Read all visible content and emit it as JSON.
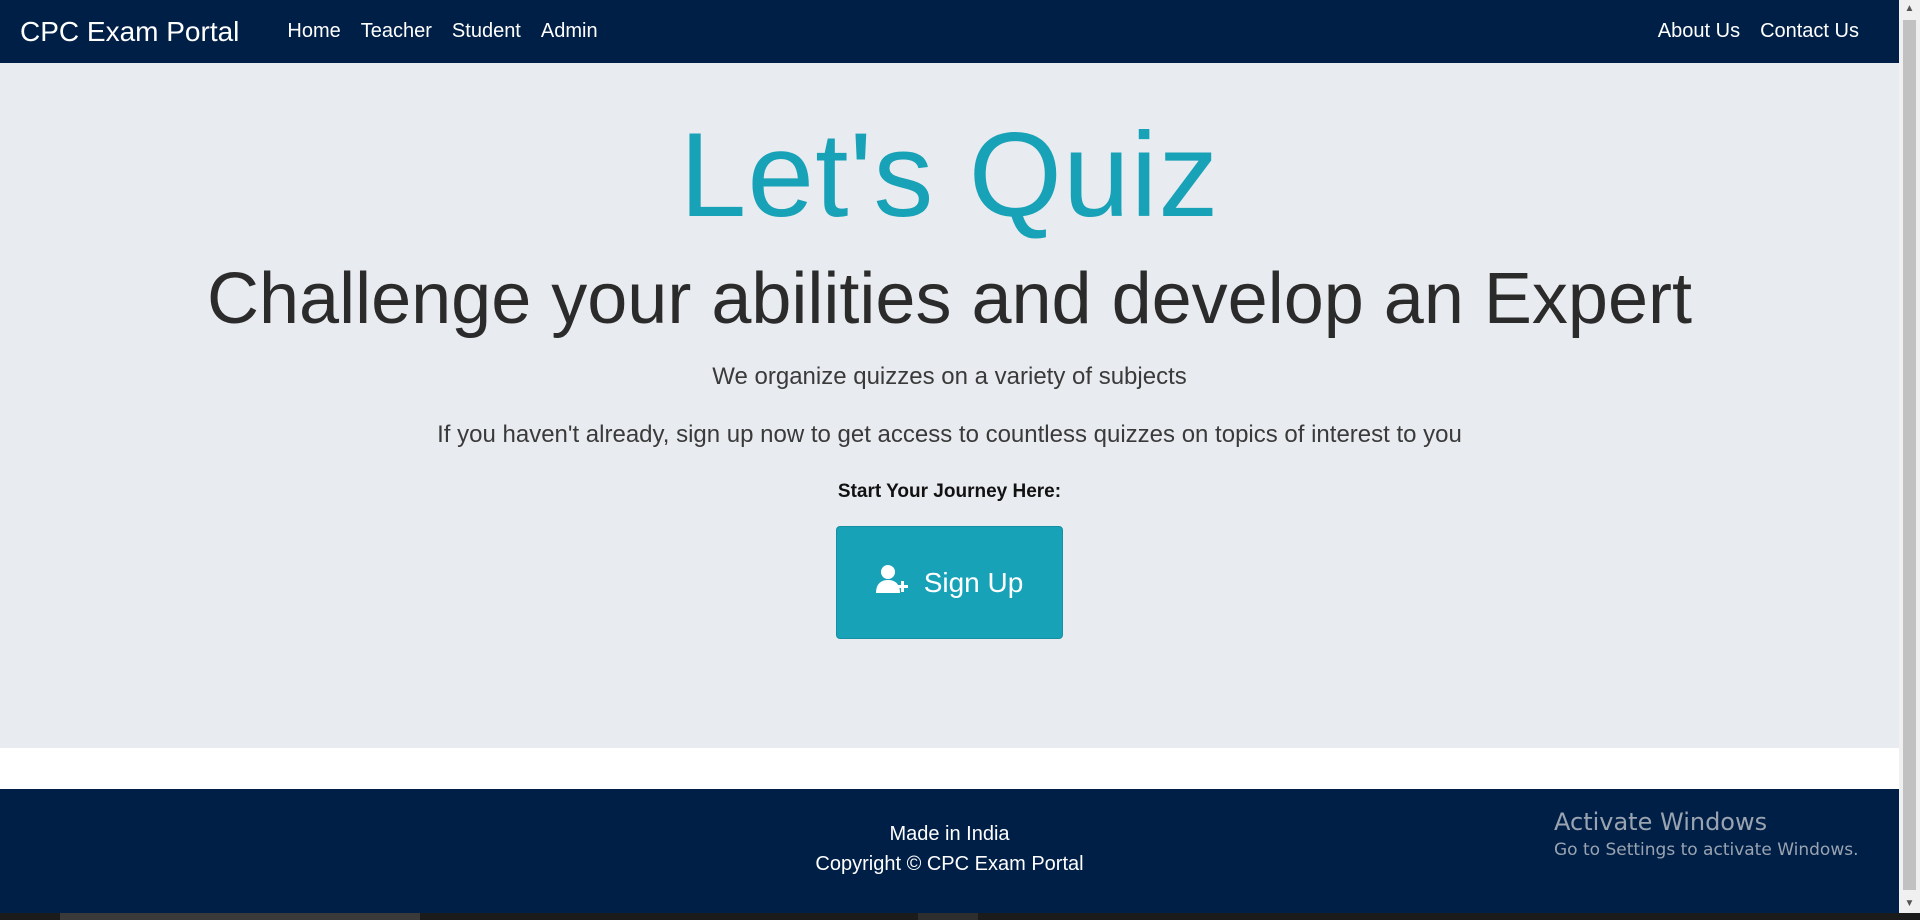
{
  "navbar": {
    "brand": "CPC Exam Portal",
    "left_links": [
      "Home",
      "Teacher",
      "Student",
      "Admin"
    ],
    "right_links": [
      "About Us",
      "Contact Us"
    ]
  },
  "hero": {
    "title": "Let's Quiz",
    "subtitle": "Challenge your abilities and develop an Expert",
    "lead_1": "We organize quizzes on a variety of subjects",
    "lead_2": "If you haven't already, sign up now to get access to countless quizzes on topics of interest to you",
    "journey_label": "Start Your Journey Here:",
    "signup_label": "Sign Up",
    "signup_icon": "user-plus-icon"
  },
  "footer": {
    "line_1": "Made in India",
    "line_2": "Copyright © CPC Exam Portal"
  },
  "overlay": {
    "activate_title": "Activate Windows",
    "activate_sub": "Go to Settings to activate Windows."
  },
  "colors": {
    "navbar_bg": "#001f47",
    "hero_bg": "#e8ebef",
    "accent": "#17a2b8"
  }
}
